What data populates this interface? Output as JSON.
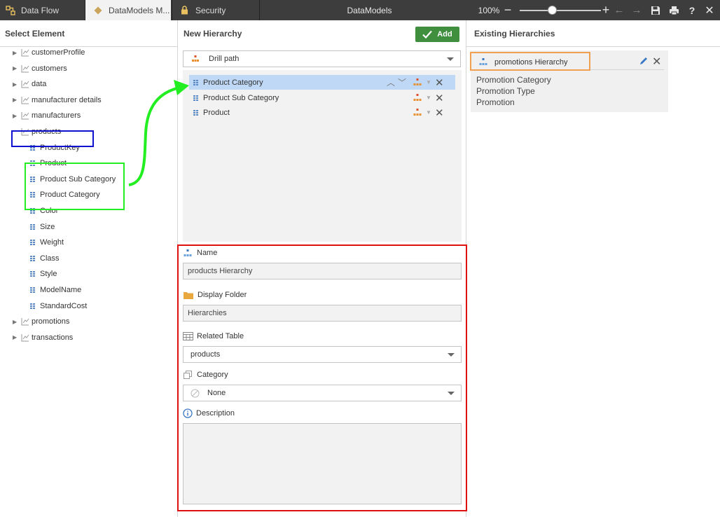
{
  "topbar": {
    "tabs": [
      {
        "label": "Data Flow"
      },
      {
        "label": "DataModels M..."
      },
      {
        "label": "Security"
      }
    ],
    "title": "DataModels",
    "zoom_level": "100%",
    "icons": [
      "data-flow-icon",
      "datamodels-icon",
      "lock-icon",
      "zoom-out-icon",
      "zoom-in-icon",
      "undo-icon",
      "redo-icon",
      "save-icon",
      "print-icon",
      "help-icon",
      "close-icon"
    ]
  },
  "left": {
    "header": "Select Element",
    "tree": [
      {
        "label": "customerProfile",
        "type": "table"
      },
      {
        "label": "customers",
        "type": "table"
      },
      {
        "label": "data",
        "type": "table"
      },
      {
        "label": "manufacturer details",
        "type": "table"
      },
      {
        "label": "manufacturers",
        "type": "table"
      },
      {
        "label": "products",
        "type": "table",
        "expanded": true,
        "children": [
          {
            "label": "ProductKey"
          },
          {
            "label": "Product"
          },
          {
            "label": "Product Sub Category"
          },
          {
            "label": "Product Category"
          },
          {
            "label": "Color"
          },
          {
            "label": "Size"
          },
          {
            "label": "Weight"
          },
          {
            "label": "Class"
          },
          {
            "label": "Style"
          },
          {
            "label": "ModelName"
          },
          {
            "label": "StandardCost"
          }
        ]
      },
      {
        "label": "promotions",
        "type": "table"
      },
      {
        "label": "transactions",
        "type": "table"
      }
    ]
  },
  "mid": {
    "header": "New Hierarchy",
    "add_label": "Add",
    "type_dropdown": {
      "value": "Drill path"
    },
    "levels": [
      {
        "label": "Product Category",
        "selected": true
      },
      {
        "label": "Product Sub Category",
        "selected": false
      },
      {
        "label": "Product",
        "selected": false
      }
    ],
    "name_label": "Name",
    "name_value": "products Hierarchy",
    "folder_label": "Display Folder",
    "folder_value": "Hierarchies",
    "table_label": "Related Table",
    "table_value": "products",
    "category_label": "Category",
    "category_value": "None",
    "description_label": "Description",
    "description_value": ""
  },
  "right": {
    "header": "Existing Hierarchies",
    "hierarchy": {
      "name": "promotions Hierarchy",
      "levels": [
        "Promotion Category",
        "Promotion Type",
        "Promotion"
      ]
    }
  },
  "colors": {
    "topbar_bg": "#3d3d3d",
    "add_button": "#3f8f3f",
    "selected_row": "#bed8f5",
    "annotation_blue": "#1010d0",
    "annotation_green": "#22ee22",
    "annotation_red": "#dd1111",
    "annotation_orange": "#f0a050"
  }
}
